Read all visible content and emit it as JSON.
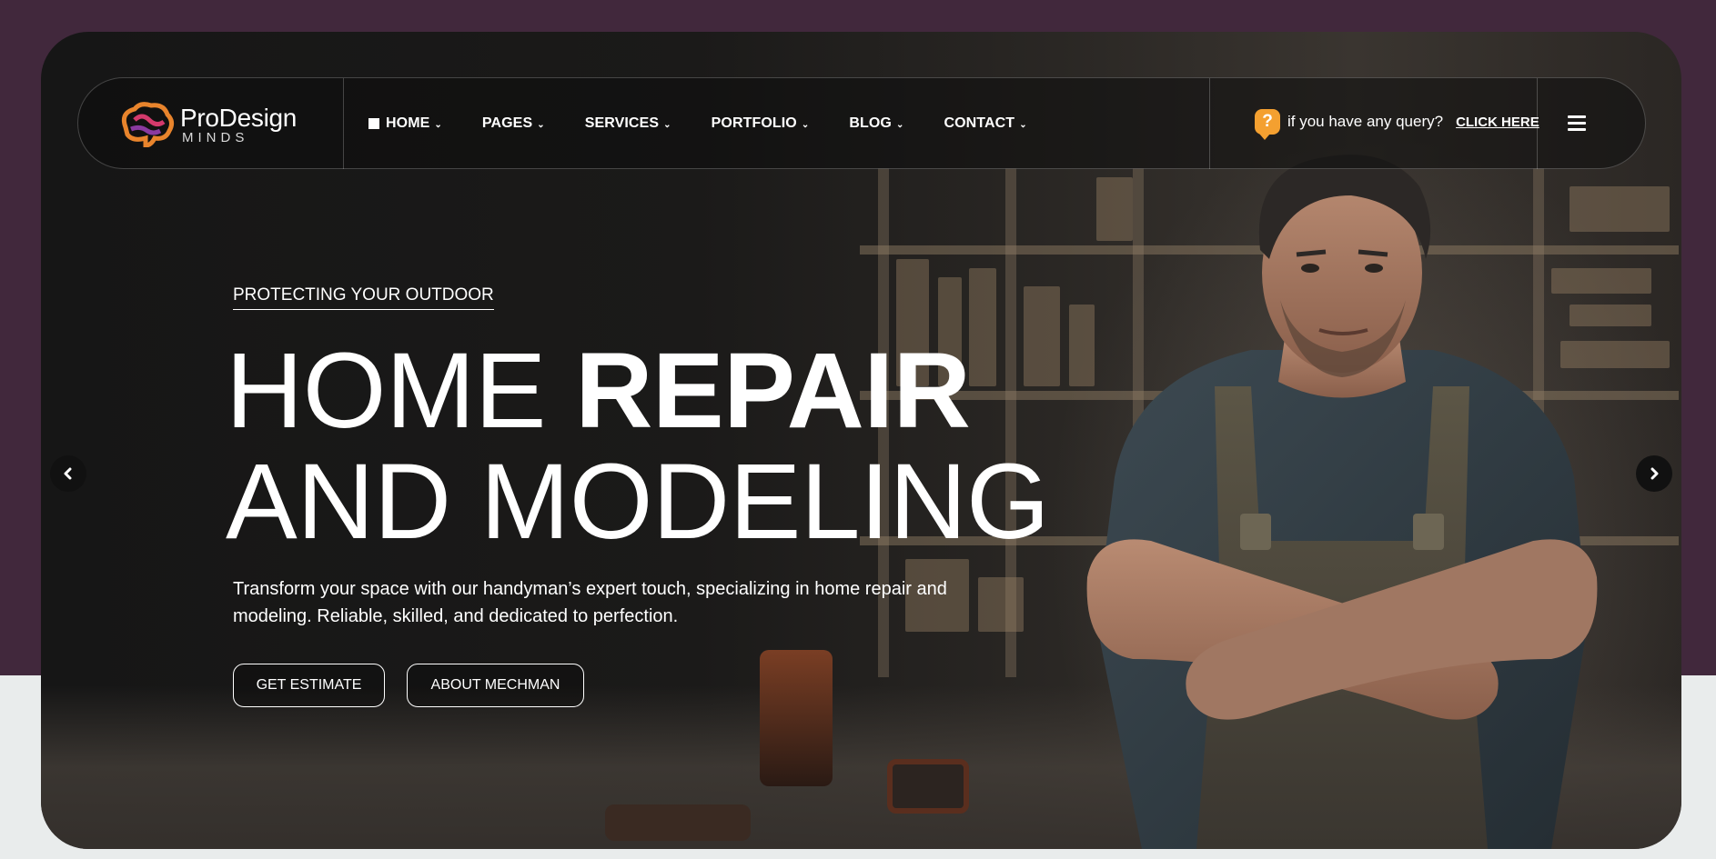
{
  "brand": {
    "name": "ProDesign",
    "tagline": "MINDS",
    "colors": {
      "background": "#41283c",
      "accent": "#f4a030"
    }
  },
  "nav": {
    "items": [
      {
        "label": "HOME"
      },
      {
        "label": "PAGES"
      },
      {
        "label": "SERVICES"
      },
      {
        "label": "PORTFOLIO"
      },
      {
        "label": "BLOG"
      },
      {
        "label": "CONTACT"
      }
    ],
    "caret": "⌄",
    "query_text": "if you have any query?",
    "query_icon_glyph": "?",
    "query_link": "CLICK HERE"
  },
  "hero": {
    "eyebrow": "PROTECTING YOUR OUTDOOR",
    "headline_line1_light": "HOME ",
    "headline_line1_bold": "REPAIR",
    "headline_line2": "AND MODELING",
    "description": "Transform your space with our handyman’s expert touch, specializing in home repair and modeling. Reliable, skilled, and dedicated to perfection.",
    "buttons": {
      "estimate": "GET ESTIMATE",
      "about": "ABOUT MECHMAN"
    }
  },
  "icons": {
    "prev": "chevron-left-icon",
    "next": "chevron-right-icon",
    "menu": "hamburger-icon",
    "query": "question-icon"
  }
}
